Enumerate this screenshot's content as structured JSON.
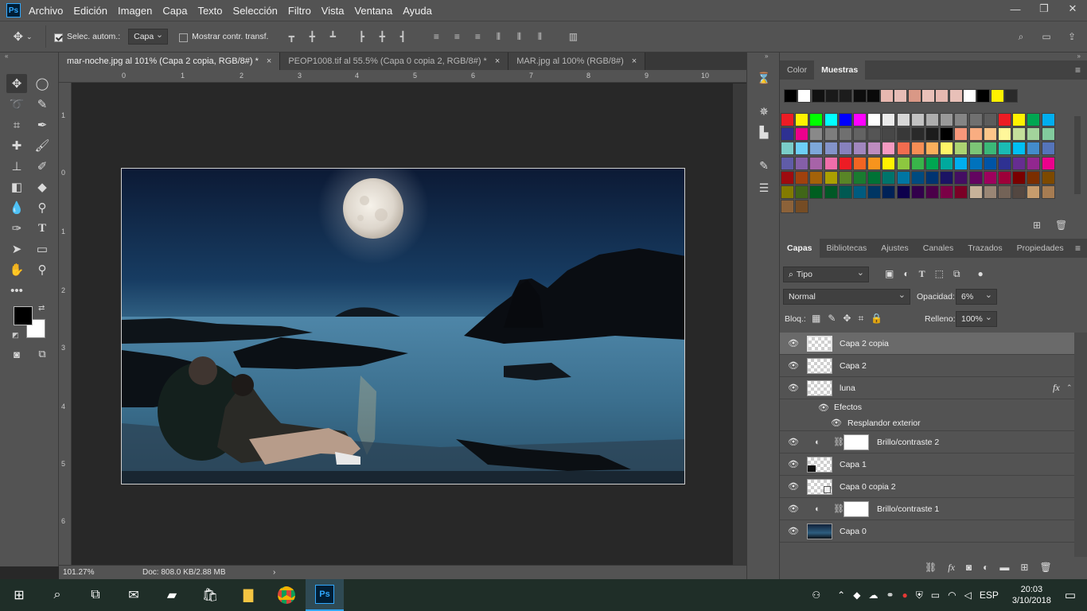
{
  "menubar": {
    "logo": "Ps",
    "items": [
      "Archivo",
      "Edición",
      "Imagen",
      "Capa",
      "Texto",
      "Selección",
      "Filtro",
      "Vista",
      "Ventana",
      "Ayuda"
    ],
    "window_controls": {
      "minimize": "—",
      "restore": "❐",
      "close": "✕"
    }
  },
  "options": {
    "auto_select_label": "Selec. autom.:",
    "auto_select_target": "Capa",
    "show_transform_label": "Mostrar contr. transf."
  },
  "tabs": [
    {
      "label": "mar-noche.jpg al 101% (Capa 2 copia, RGB/8#) *",
      "close": "×",
      "active": true
    },
    {
      "label": "PEOP1008.tif al 55.5% (Capa 0 copia 2, RGB/8#) *",
      "close": "×",
      "active": false
    },
    {
      "label": "MAR.jpg al 100% (RGB/8#)",
      "close": "×",
      "active": false
    }
  ],
  "rulers": {
    "h": [
      "0",
      "1",
      "2",
      "3",
      "4",
      "5",
      "6",
      "7",
      "8",
      "9",
      "10"
    ],
    "v": [
      "1",
      "0",
      "1",
      "2",
      "3",
      "4",
      "5",
      "6"
    ]
  },
  "status": {
    "zoom": "101.27%",
    "doc": "Doc: 808.0 KB/2.88 MB",
    "arrow": "›"
  },
  "color_panel": {
    "tabs": [
      "Color",
      "Muestras"
    ],
    "active_tab": "Muestras",
    "recent_swatches": [
      "#000000",
      "#ffffff",
      "#111111",
      "#1a1a1a",
      "#1c1c1c",
      "#0d0d0d",
      "#0a0a0a",
      "#e8b8b0",
      "#e6bcb6",
      "#d99886",
      "#e9c0b8",
      "#e6b8b0",
      "#e8c0b8",
      "#ffffff",
      "#000000",
      "#fff200",
      "#2a2a2a"
    ],
    "swatch_rows": [
      [
        "#ed1c24",
        "#fff200",
        "#00ff00",
        "#00ffff",
        "#0000ff",
        "#ff00ff",
        "#ffffff",
        "#ebebeb",
        "#d6d6d6",
        "#c2c2c2",
        "#adadad",
        "#999999",
        "#858585",
        "#707070",
        "#5c5c5c",
        "#ed1c24",
        "#fff200",
        "#00a651",
        "#00aeef"
      ],
      [
        "#2e3192",
        "#ec008c",
        "#898989",
        "#7d7d7d",
        "#707070",
        "#636363",
        "#555555",
        "#474747",
        "#383838",
        "#2a2a2a",
        "#1c1c1c",
        "#000000",
        "#f7977a",
        "#f9ad81",
        "#fdc68a",
        "#fff79a",
        "#c4df9b",
        "#a3d39c",
        "#82ca9d"
      ],
      [
        "#7accc8",
        "#6dcff6",
        "#7da7d9",
        "#8393ca",
        "#8781bd",
        "#a186be",
        "#bd8cbf",
        "#f49ac1",
        "#f26c4f",
        "#f68e55",
        "#fbaf5c",
        "#fff467",
        "#acd372",
        "#7cc576",
        "#3bb878",
        "#1abbb4",
        "#00bff3",
        "#438ccb",
        "#5574b9"
      ],
      [
        "#605ca8",
        "#855fa8",
        "#a763a8",
        "#f06eaa",
        "#ed1c24",
        "#f26522",
        "#f7941d",
        "#fff200",
        "#8dc73f",
        "#39b54a",
        "#00a651",
        "#00a99d",
        "#00aeef",
        "#0072bc",
        "#0054a6",
        "#2e3192",
        "#662d91",
        "#92278f",
        "#ec008c"
      ],
      [
        "#9e0b0f",
        "#a0410d",
        "#a36209",
        "#aba000",
        "#598527",
        "#1a7b30",
        "#007236",
        "#00746b",
        "#0076a3",
        "#004b80",
        "#003471",
        "#1b1464",
        "#440e62",
        "#630460",
        "#9e005d",
        "#9e0039",
        "#790000",
        "#7b2e00",
        "#7d4900"
      ],
      [
        "#827b00",
        "#406618",
        "#005e20",
        "#005826",
        "#005952",
        "#005b7f",
        "#003663",
        "#002157",
        "#0d004c",
        "#32004b",
        "#4b0049",
        "#7b0046",
        "#7a0026",
        "#c7b299",
        "#998675",
        "#736357",
        "#534741",
        "#c69c6d",
        "#a67c52"
      ],
      [
        "#8c6239",
        "#754c24"
      ]
    ]
  },
  "layers_panel": {
    "tabs": [
      "Capas",
      "Bibliotecas",
      "Ajustes",
      "Canales",
      "Trazados",
      "Propiedades"
    ],
    "active_tab": "Capas",
    "filter_label": "Tipo",
    "blend_mode": "Normal",
    "opacity_label": "Opacidad:",
    "opacity_value": "6%",
    "lock_label": "Bloq.:",
    "fill_label": "Relleno:",
    "fill_value": "100%",
    "layers": [
      {
        "name": "Capa 2 copia",
        "type": "pixel",
        "selected": true
      },
      {
        "name": "Capa 2",
        "type": "pixel",
        "selected": false
      },
      {
        "name": "luna",
        "type": "pixel",
        "selected": false,
        "fx": "fx"
      },
      {
        "name": "Efectos",
        "type": "effects-header"
      },
      {
        "name": "Resplandor exterior",
        "type": "effect"
      },
      {
        "name": "Brillo/contraste 2",
        "type": "adjustment"
      },
      {
        "name": "Capa 1",
        "type": "pixel-dark"
      },
      {
        "name": "Capa 0 copia 2",
        "type": "smart"
      },
      {
        "name": "Brillo/contraste 1",
        "type": "adjustment"
      },
      {
        "name": "Capa 0",
        "type": "photo"
      }
    ]
  },
  "taskbar": {
    "tray_lang": "ESP",
    "time": "20:03",
    "date": "3/10/2018"
  },
  "colors": {
    "accent": "#31a8ff",
    "panel": "#535353",
    "dark": "#282828"
  }
}
